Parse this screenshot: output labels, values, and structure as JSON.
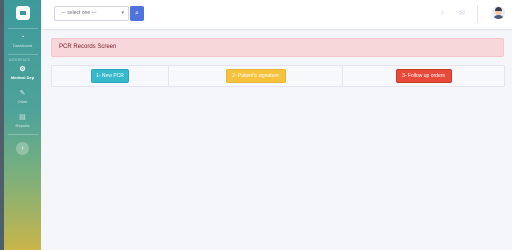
{
  "sidebar": {
    "items": [
      {
        "icon": "dashboard-icon",
        "glyph": "◔",
        "label": "Dashboard"
      },
      {
        "icon": "gear-icon",
        "glyph": "⚙",
        "label": "Medical Dep"
      },
      {
        "icon": "wrench-icon",
        "glyph": "✎",
        "label": "Other"
      },
      {
        "icon": "reports-icon",
        "glyph": "▤",
        "label": "Reports"
      }
    ],
    "heading": "INTERFACE",
    "toggle_glyph": "›"
  },
  "topbar": {
    "select_value": "--- select one ---",
    "caret": "▾",
    "search_glyph": "⌕",
    "bell_glyph": "♪",
    "mail_glyph": "✉"
  },
  "main": {
    "alert": "PCR Records Screen",
    "actions": [
      {
        "label": "1- New PCR",
        "color": "#36b9cc"
      },
      {
        "label": "2- Patient's signature",
        "color": "#f6c23e"
      },
      {
        "label": "3- Follow up orders",
        "color": "#e74a3b"
      }
    ]
  }
}
